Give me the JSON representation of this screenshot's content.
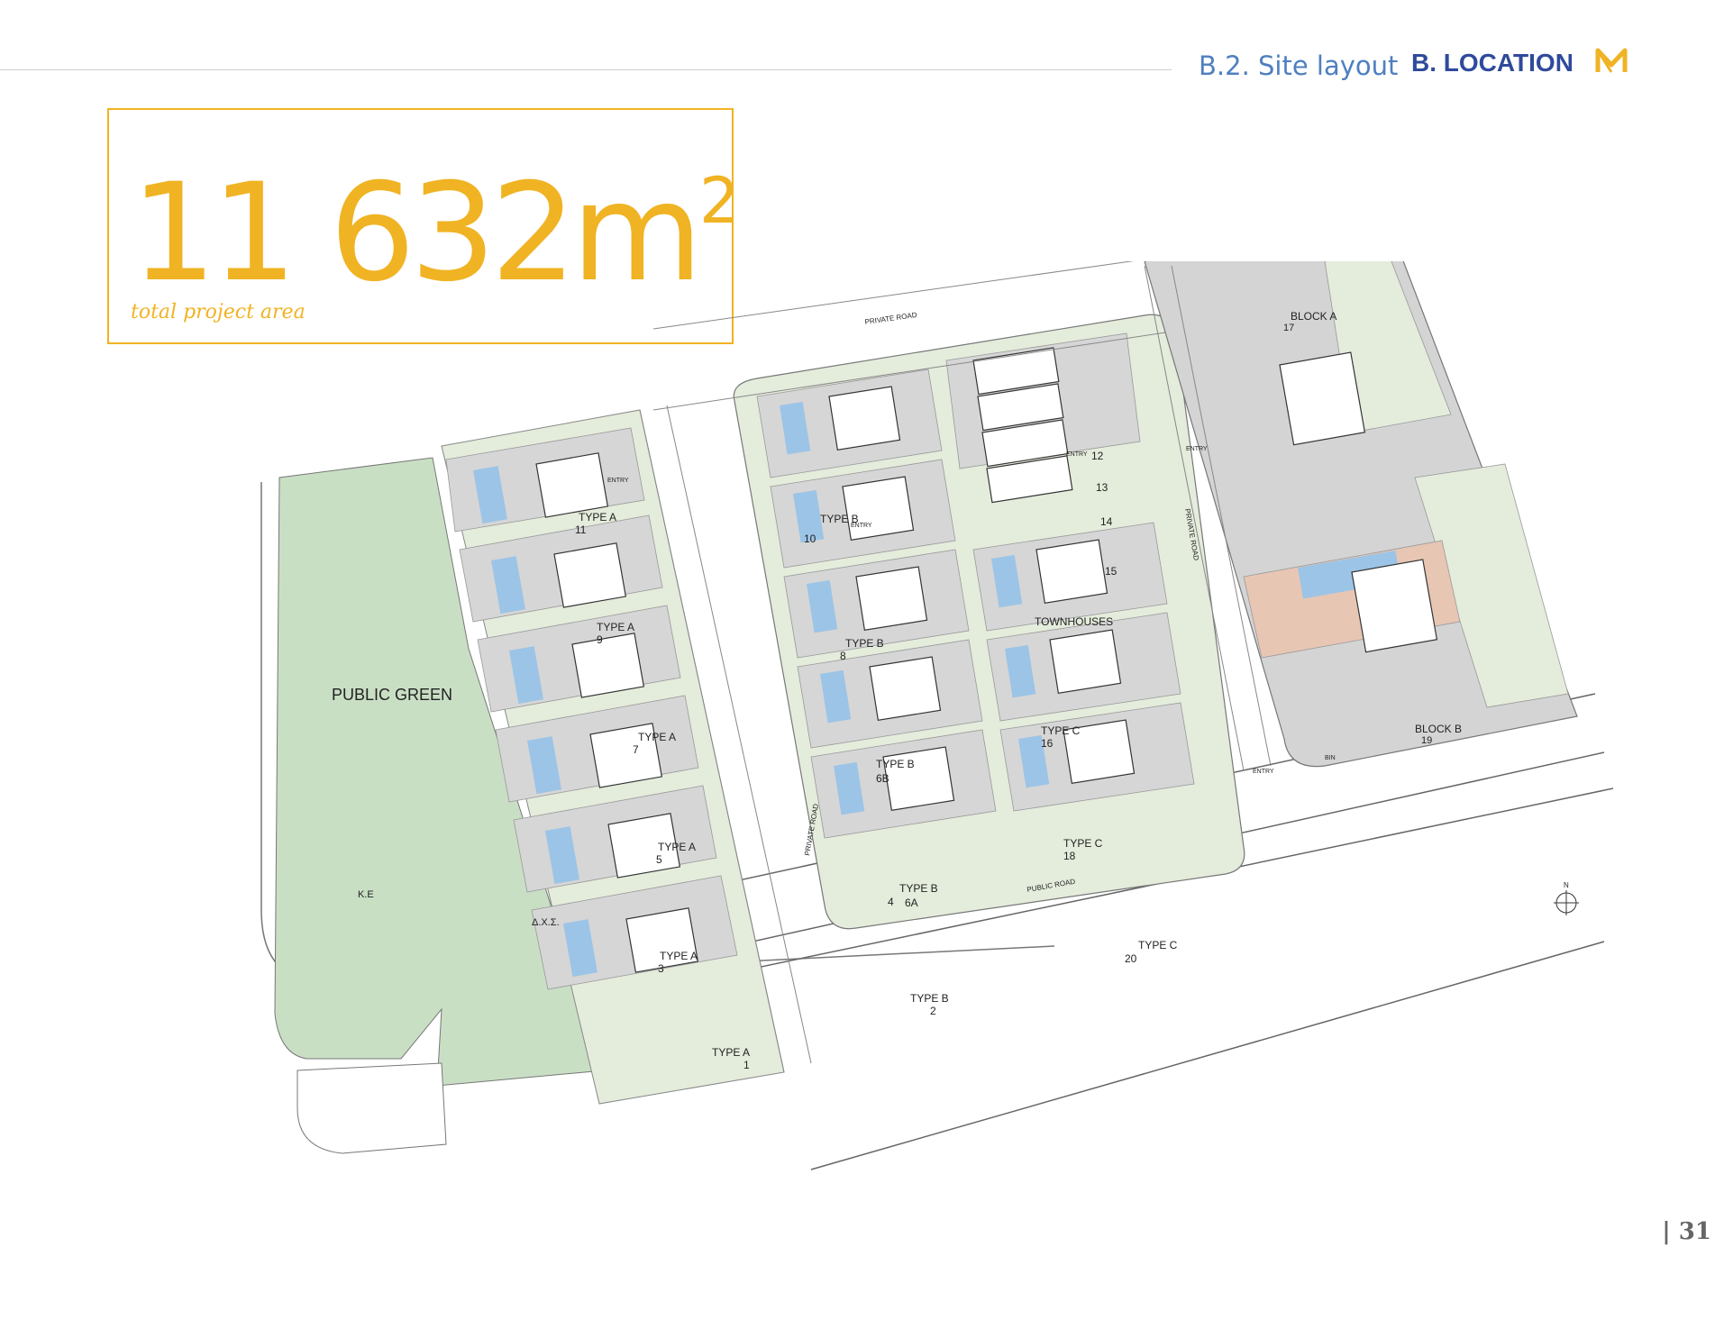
{
  "header": {
    "section_sub": "B.2. Site layout",
    "section_main": "B. LOCATION",
    "logo_icon": "m-logo-icon",
    "accent_color": "#f0b323",
    "title_color": "#2f4a9c"
  },
  "area": {
    "value": "11 632m",
    "exponent": "2",
    "caption": "total project area"
  },
  "plan": {
    "public_green": "PUBLIC GREEN",
    "ke": "K.E",
    "dxs": "Δ.Χ.Σ.",
    "private_road_top": "PRIVATE ROAD",
    "private_road_mid": "PRIVATE ROAD",
    "private_road_right": "PRIVATE ROAD",
    "public_road": "PUBLIC ROAD",
    "townhouses": "TOWNHOUSES",
    "block_a": "BLOCK A",
    "block_a_num": "17",
    "block_b": "BLOCK B",
    "block_b_num": "19",
    "bin": "BIN",
    "north": "N",
    "entry": "ENTRY",
    "units": [
      {
        "type": "TYPE A",
        "num": "11"
      },
      {
        "type": "TYPE A",
        "num": "9"
      },
      {
        "type": "TYPE A",
        "num": "7"
      },
      {
        "type": "TYPE A",
        "num": "5"
      },
      {
        "type": "TYPE A",
        "num": "3"
      },
      {
        "type": "TYPE A",
        "num": "1"
      },
      {
        "type": "TYPE B",
        "num": "10"
      },
      {
        "type": "TYPE B",
        "num": "8"
      },
      {
        "type": "TYPE B",
        "num": "6B"
      },
      {
        "type": "TYPE B",
        "num": "4"
      },
      {
        "type": "TYPE B",
        "num": "2"
      },
      {
        "type": "TYPE C",
        "num": "16"
      },
      {
        "type": "TYPE C",
        "num": "18"
      },
      {
        "type": "TYPE C",
        "num": "20"
      }
    ],
    "unit_6a": "6A",
    "townhouse_nums": [
      "12",
      "13",
      "14",
      "15"
    ]
  },
  "page": {
    "number": "| 31"
  }
}
